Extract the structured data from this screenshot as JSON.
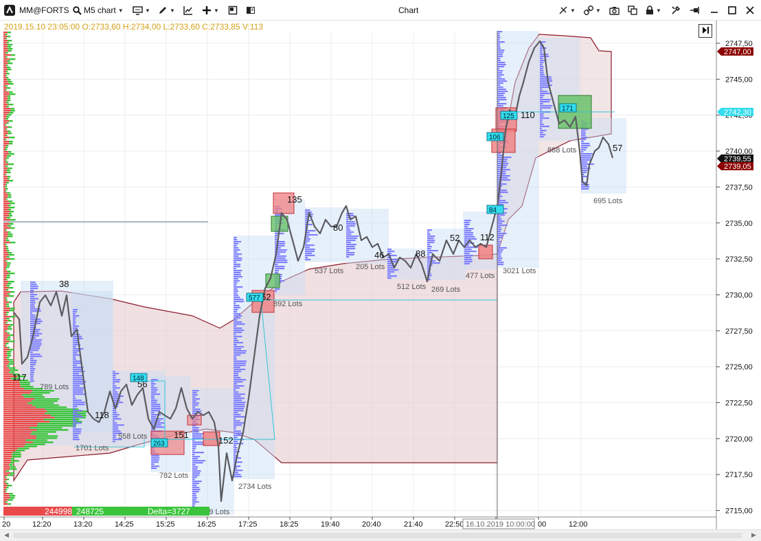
{
  "toolbar": {
    "app_icon": "bars-logo-icon",
    "symbol": "MM@FORTS",
    "timeframe": "M5 chart",
    "title": "Chart"
  },
  "ohlc_text": "2019.15.10 23:05:00 O:2733,60 H:2734,00 L:2733,60 C:2733,85 V:113",
  "price_axis": {
    "ticks": [
      "2747,50",
      "2745,00",
      "2742,50",
      "2740,00",
      "2737,50",
      "2735,00",
      "2732,50",
      "2730,00",
      "2727,50",
      "2725,00",
      "2722,50",
      "2720,00",
      "2717,50",
      "2715,00"
    ],
    "tags": [
      {
        "value": "2747,00",
        "bg": "#8b0000",
        "fg": "#ffffff"
      },
      {
        "value": "2742,30",
        "bg": "#33dcee",
        "fg": "#ffffff"
      },
      {
        "value": "2739,55",
        "bg": "#111111",
        "fg": "#ffffff"
      },
      {
        "value": "2739,05",
        "bg": "#8b0000",
        "fg": "#ffffff"
      }
    ]
  },
  "time_axis": {
    "ticks": [
      "20",
      "12:20",
      "13:20",
      "14:25",
      "15:25",
      "16:25",
      "17:25",
      "18:25",
      "19:40",
      "20:40",
      "21:40",
      "22:50",
      "00",
      "12:00"
    ],
    "cursor_label": "16.10.2019 10:00:00"
  },
  "volume_labels": [
    {
      "text": "38",
      "color": "#111"
    },
    {
      "text": "117",
      "color": "#111"
    },
    {
      "text": "118",
      "color": "#111"
    },
    {
      "text": "56",
      "color": "#111"
    },
    {
      "text": "151",
      "color": "#111"
    },
    {
      "text": "152",
      "color": "#111"
    },
    {
      "text": "135",
      "color": "#111"
    },
    {
      "text": "80",
      "color": "#111"
    },
    {
      "text": "46",
      "color": "#111"
    },
    {
      "text": "88",
      "color": "#111"
    },
    {
      "text": "52",
      "color": "#111"
    },
    {
      "text": "112",
      "color": "#111"
    },
    {
      "text": "110",
      "color": "#111"
    },
    {
      "text": "57",
      "color": "#111"
    },
    {
      "text": "62",
      "color": "#111"
    }
  ],
  "lots_labels": [
    "789 Lots",
    "1701 Lots",
    "558 Lots",
    "782 Lots",
    "2079 Lots",
    "2734 Lots",
    "892 Lots",
    "537 Lots",
    "205 Lots",
    "512 Lots",
    "269 Lots",
    "477 Lots",
    "3021 Lots",
    "888 Lots",
    "695 Lots"
  ],
  "cyan_tags": [
    "148",
    "263",
    "577",
    "84",
    "106",
    "125",
    "171"
  ],
  "footer_bar": {
    "sell": "244998",
    "buy": "248725",
    "delta": "Delta=3727"
  },
  "colors": {
    "grid": "#e9eaef",
    "price_line": "#5a5a5f",
    "profile_blue": "#8080ff",
    "ask_green": "#3bc43b",
    "bid_red": "#e84a4a",
    "value_area": "#c8ddf5",
    "cluster_band": "#e8c8c8",
    "ohlc_text": "#d4a017"
  }
}
